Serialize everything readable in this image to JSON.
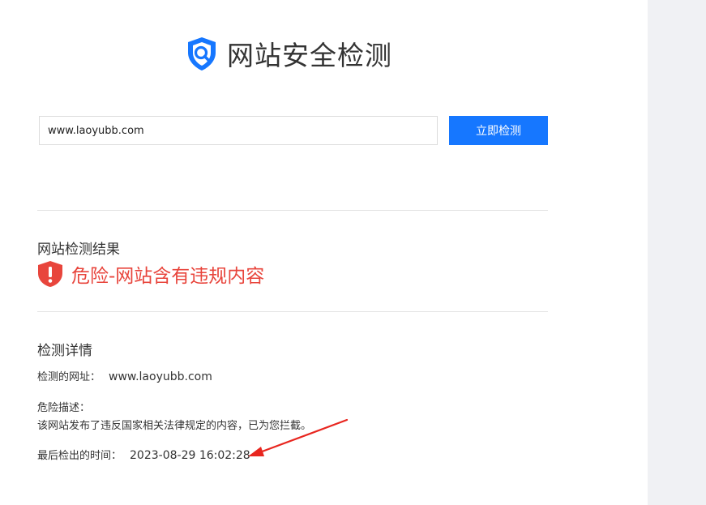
{
  "header": {
    "title": "网站安全检测",
    "logo_icon": "shield-search-icon"
  },
  "search": {
    "value": "www.laoyubb.com",
    "button_label": "立即检测"
  },
  "result": {
    "heading": "网站检测结果",
    "status_icon": "danger-shield-icon",
    "status_text": "危险-网站含有违规内容",
    "status_color": "#e8453c"
  },
  "details": {
    "heading": "检测详情",
    "url_label": "检测的网址：",
    "url_value": "www.laoyubb.com",
    "risk_label": "危险描述：",
    "risk_text": "该网站发布了违反国家相关法律规定的内容，已为您拦截。",
    "time_label": "最后检出的时间：",
    "time_value": "2023-08-29 16:02:28"
  },
  "colors": {
    "accent": "#1677ff",
    "danger": "#e8453c",
    "annotation_arrow": "#e8261f"
  }
}
